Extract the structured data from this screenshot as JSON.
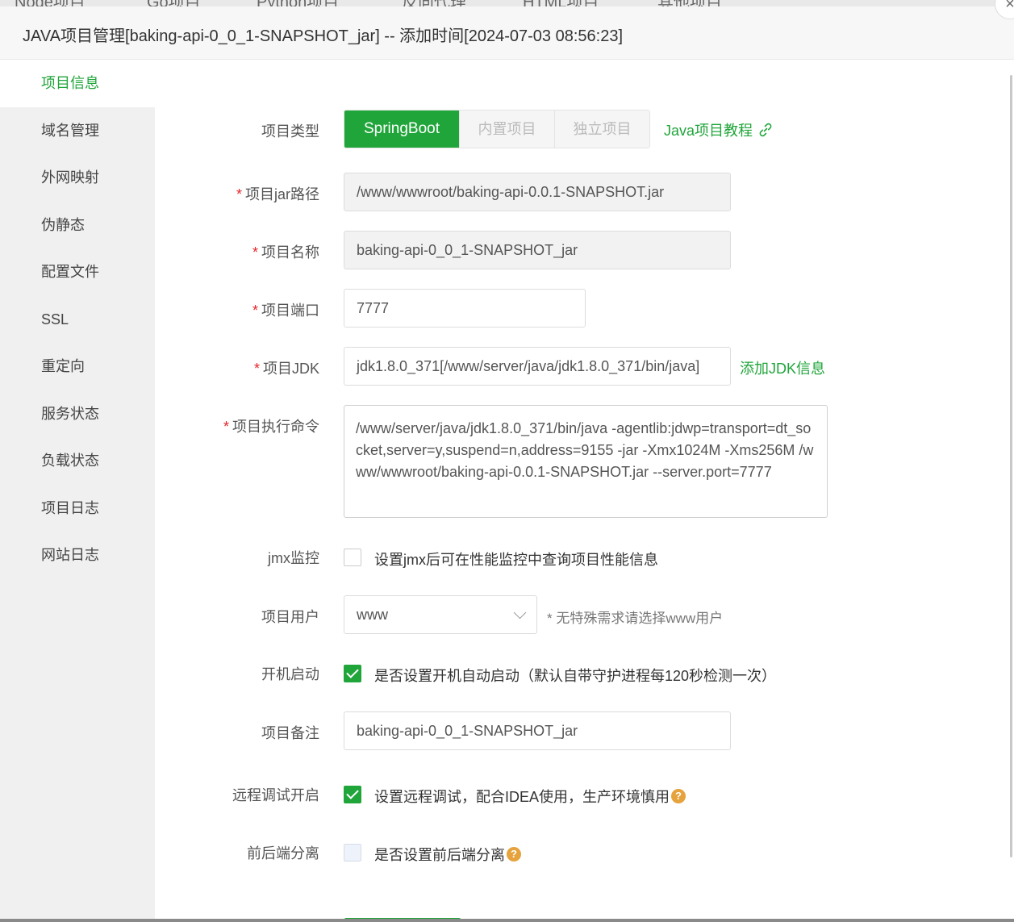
{
  "background_tabs": [
    "Node项目",
    "Go项目",
    "Python项目",
    "反向代理",
    "HTML项目",
    "其他项目"
  ],
  "dialog": {
    "title": "JAVA项目管理[baking-api-0_0_1-SNAPSHOT_jar] -- 添加时间[2024-07-03 08:56:23]",
    "close_label": "×"
  },
  "sidebar": {
    "items": [
      "项目信息",
      "域名管理",
      "外网映射",
      "伪静态",
      "配置文件",
      "SSL",
      "重定向",
      "服务状态",
      "负载状态",
      "项目日志",
      "网站日志"
    ],
    "active": "项目信息"
  },
  "form": {
    "project_type": {
      "label": "项目类型",
      "options": [
        "SpringBoot",
        "内置项目",
        "独立项目"
      ],
      "selected": "SpringBoot",
      "tutorial_link": "Java项目教程"
    },
    "jar_path": {
      "label": "项目jar路径",
      "value": "/www/wwwroot/baking-api-0.0.1-SNAPSHOT.jar"
    },
    "name": {
      "label": "项目名称",
      "value": "baking-api-0_0_1-SNAPSHOT_jar"
    },
    "port": {
      "label": "项目端口",
      "value": "7777"
    },
    "jdk": {
      "label": "项目JDK",
      "value": "jdk1.8.0_371[/www/server/java/jdk1.8.0_371/bin/java]",
      "add_link": "添加JDK信息"
    },
    "command": {
      "label": "项目执行命令",
      "value": "/www/server/java/jdk1.8.0_371/bin/java -agentlib:jdwp=transport=dt_socket,server=y,suspend=n,address=9155  -jar -Xmx1024M -Xms256M  /www/wwwroot/baking-api-0.0.1-SNAPSHOT.jar --server.port=7777"
    },
    "jmx": {
      "label": "jmx监控",
      "checked": false,
      "text": "设置jmx后可在性能监控中查询项目性能信息"
    },
    "user": {
      "label": "项目用户",
      "value": "www",
      "hint": "* 无特殊需求请选择www用户"
    },
    "autostart": {
      "label": "开机启动",
      "checked": true,
      "text": "是否设置开机自动启动（默认自带守护进程每120秒检测一次）"
    },
    "remark": {
      "label": "项目备注",
      "value": "baking-api-0_0_1-SNAPSHOT_jar"
    },
    "remote_debug": {
      "label": "远程调试开启",
      "checked": true,
      "text": "设置远程调试，配合IDEA使用，生产环境慎用"
    },
    "separation": {
      "label": "前后端分离",
      "checked": false,
      "text": "是否设置前后端分离"
    }
  },
  "colors": {
    "accent": "#20a53a",
    "required": "#e5252a",
    "help": "#e6a23c"
  }
}
